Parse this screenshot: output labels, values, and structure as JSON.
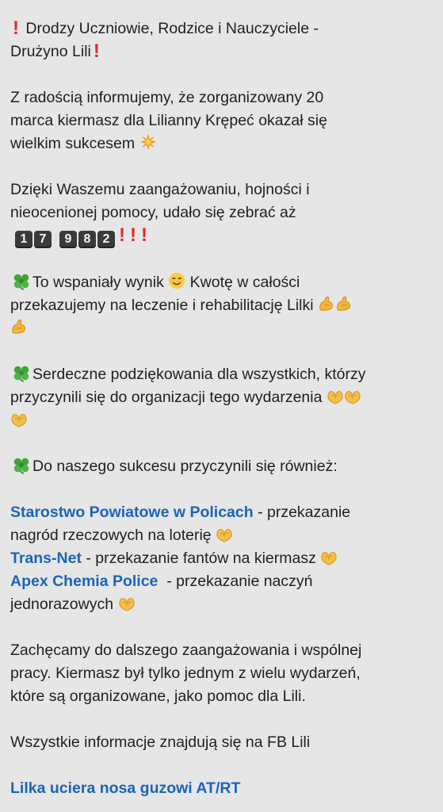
{
  "post": {
    "greeting_line1": "Drodzy Uczniowie, Rodzice i Nauczyciele -",
    "greeting_line2": "Drużyno Lili",
    "p1_line1": "Z radością informujemy, że zorganizowany 20",
    "p1_line2": "marca kiermasz dla Lilianny Krępeć okazał się",
    "p1_line3": "wielkim sukcesem",
    "p2_line1": "Dzięki Waszemu zaangażowaniu, hojności i",
    "p2_line2": "nieocenionej pomocy, udało się zebrać aż",
    "amount_digits_group1": [
      "1",
      "7"
    ],
    "amount_digits_group2": [
      "9",
      "8",
      "2"
    ],
    "p3_line1a": "To wspaniały wynik",
    "p3_line1b": "Kwotę w całości",
    "p3_line2": "przekazujemy na leczenie i rehabilitację Lilki",
    "p4_line1": "Serdeczne podziękowania dla wszystkich, którzy",
    "p4_line2": "przyczynili się do organizacji tego wydarzenia",
    "p5_line1": "Do naszego sukcesu przyczynili się również:",
    "sponsor1_name": "Starostwo Powiatowe w Policach",
    "sponsor1_desc_a": " - przekazanie",
    "sponsor1_desc_b": "nagród rzeczowych na loterię",
    "sponsor2_name": "Trans-Net",
    "sponsor2_desc": " - przekazanie fantów na kiermasz",
    "sponsor3_name": "Apex Chemia Police",
    "sponsor3_desc_a": "  - przekazanie naczyń",
    "sponsor3_desc_b": "jednorazowych",
    "p6_line1": "Zachęcamy do dalszego zaangażowania i wspólnej",
    "p6_line2": "pracy. Kiermasz był tylko jednym z wielu wydarzeń,",
    "p6_line3": "które są organizowane, jako pomoc dla Lili.",
    "p7_line1": "Wszystkie informacje znajdują się na FB Lili",
    "fb_link": "Lilka uciera nosa guzowi AT/RT"
  },
  "colors": {
    "background": "#e6e6e6",
    "text": "#1f1f1f",
    "link": "#1b64b8",
    "exclamation": "#e2262a"
  },
  "icons": [
    "red-exclamation-icon",
    "collision-icon",
    "keycap-digit-icon",
    "four-leaf-clover-icon",
    "smiling-face-icon",
    "flexed-biceps-icon",
    "heart-hands-icon"
  ]
}
